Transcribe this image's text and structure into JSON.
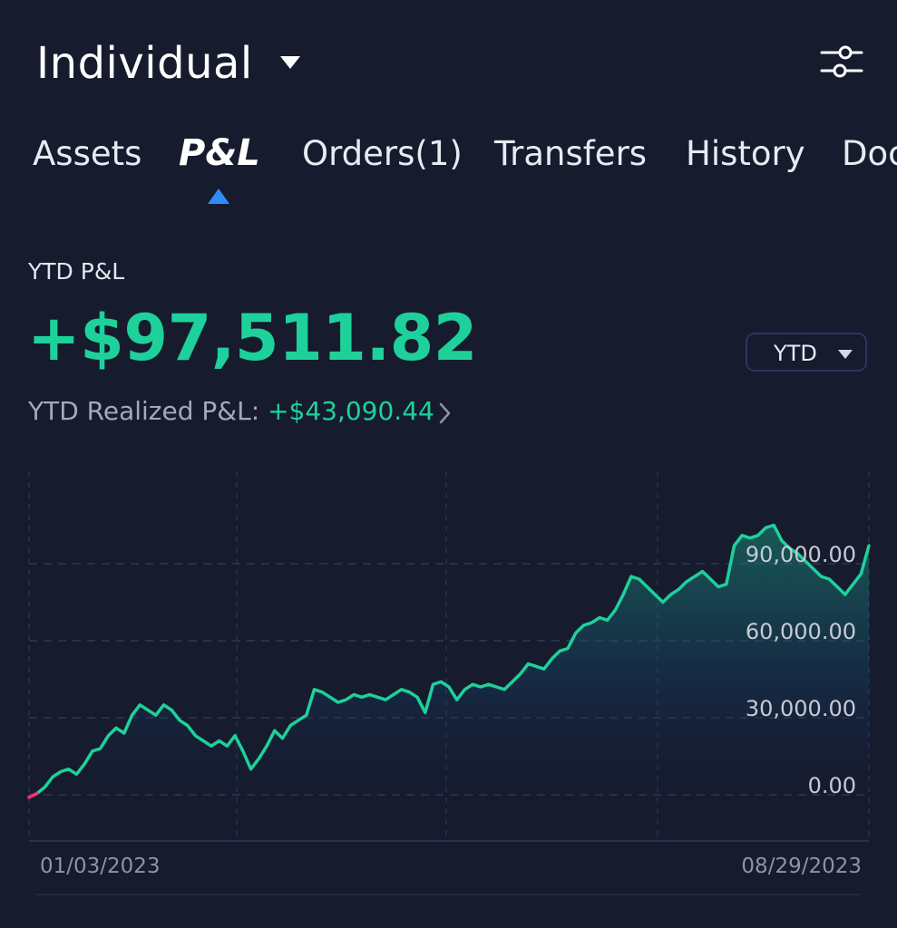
{
  "header": {
    "account_name": "Individual",
    "dropdown_icon": "caret-down-icon",
    "settings_icon": "sliders-icon"
  },
  "tabs": [
    {
      "label": "Assets",
      "active": false
    },
    {
      "label": "P&L",
      "active": true
    },
    {
      "label": "Orders(1)",
      "active": false
    },
    {
      "label": "Transfers",
      "active": false
    },
    {
      "label": "History",
      "active": false
    },
    {
      "label": "Doc",
      "active": false
    }
  ],
  "summary": {
    "ytd_label": "YTD P&L",
    "total_value": "+$97,511.82",
    "period": "YTD",
    "realized_label": "YTD Realized P&L: ",
    "realized_value": "+$43,090.44"
  },
  "colors": {
    "background": "#161b2e",
    "positive": "#1ed19a",
    "negative": "#ff2d6b",
    "accent": "#2f8bf5"
  },
  "chart_data": {
    "type": "area",
    "y_ticks": [
      "90,000.00",
      "60,000.00",
      "30,000.00",
      "0.00"
    ],
    "x_labels": [
      "01/03/2023",
      "08/29/2023"
    ],
    "ylim": [
      -18000,
      126000
    ],
    "grid": true,
    "series": [
      {
        "values": [
          -1000,
          500,
          3000,
          7000,
          9000,
          10000,
          8000,
          12000,
          17000,
          18000,
          23000,
          26000,
          24000,
          31000,
          35000,
          33000,
          31000,
          35000,
          33000,
          29000,
          27000,
          23000,
          21000,
          19000,
          21000,
          19000,
          23000,
          17000,
          10000,
          14000,
          19000,
          25000,
          22000,
          27000,
          29000,
          31000,
          41000,
          40000,
          38000,
          36000,
          37000,
          39000,
          38000,
          39000,
          38000,
          37000,
          39000,
          41000,
          40000,
          38000,
          32000,
          43000,
          44000,
          42000,
          37000,
          41000,
          43000,
          42000,
          43000,
          42000,
          41000,
          44000,
          47000,
          51000,
          50000,
          49000,
          53000,
          56000,
          57000,
          63000,
          66000,
          67000,
          69000,
          68000,
          72000,
          78000,
          85000,
          84000,
          81000,
          78000,
          75000,
          78000,
          80000,
          83000,
          85000,
          87000,
          84000,
          81000,
          82000,
          97000,
          101000,
          100000,
          101000,
          104000,
          105000,
          99000,
          96000,
          94000,
          91000,
          88000,
          85000,
          84000,
          81000,
          78000,
          82000,
          86000,
          97000
        ]
      }
    ]
  }
}
